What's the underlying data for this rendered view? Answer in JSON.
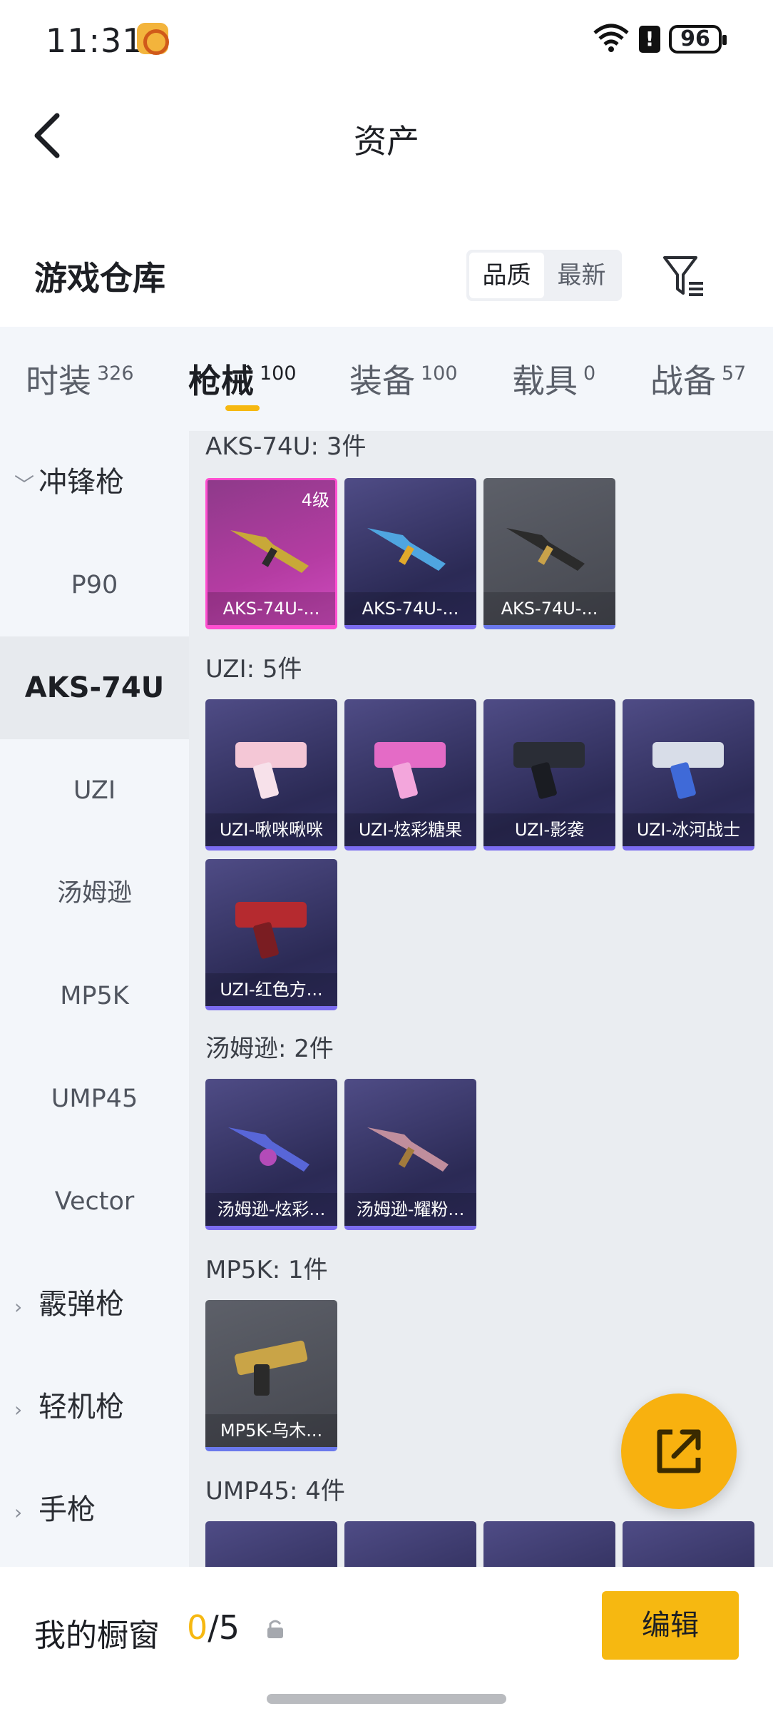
{
  "status_bar": {
    "time": "11:31",
    "battery": "96",
    "battery_alert": "!"
  },
  "header": {
    "title": "资产"
  },
  "warehouse": {
    "title": "游戏仓库",
    "sort_options": [
      "品质",
      "最新"
    ],
    "active_sort": "品质"
  },
  "tabs": [
    {
      "label": "时装",
      "count": "326"
    },
    {
      "label": "枪械",
      "count": "100"
    },
    {
      "label": "装备",
      "count": "100"
    },
    {
      "label": "载具",
      "count": "0"
    },
    {
      "label": "战备",
      "count": "57"
    }
  ],
  "active_tab": "枪械",
  "sidebar": {
    "categories": {
      "smg": "冲锋枪",
      "shotgun": "霰弹枪",
      "lmg": "轻机枪",
      "pistol": "手枪"
    },
    "smg_items": [
      "P90",
      "AKS-74U",
      "UZI",
      "汤姆逊",
      "MP5K",
      "UMP45",
      "Vector"
    ],
    "selected_item": "AKS-74U"
  },
  "groups": [
    {
      "label": "AKS-74U: 3件",
      "items": [
        {
          "name": "AKS-74U-...",
          "level": "4级",
          "rarity": "pink"
        },
        {
          "name": "AKS-74U-...",
          "rarity": "purple"
        },
        {
          "name": "AKS-74U-...",
          "rarity": "gray"
        }
      ]
    },
    {
      "label": "UZI: 5件",
      "items": [
        {
          "name": "UZI-啾咪啾咪",
          "rarity": "purple"
        },
        {
          "name": "UZI-炫彩糖果",
          "rarity": "purple"
        },
        {
          "name": "UZI-影袭",
          "rarity": "purple"
        },
        {
          "name": "UZI-冰河战士",
          "rarity": "purple"
        },
        {
          "name": "UZI-红色方...",
          "rarity": "purple"
        }
      ]
    },
    {
      "label": "汤姆逊: 2件",
      "items": [
        {
          "name": "汤姆逊-炫彩...",
          "rarity": "purple"
        },
        {
          "name": "汤姆逊-耀粉...",
          "rarity": "purple"
        }
      ]
    },
    {
      "label": "MP5K: 1件",
      "items": [
        {
          "name": "MP5K-乌木...",
          "rarity": "gray"
        }
      ]
    },
    {
      "label": "UMP45: 4件",
      "items": []
    }
  ],
  "bottom_bar": {
    "showcase_label": "我的橱窗",
    "showcase_current": "0",
    "showcase_total": "/5",
    "edit_label": "编辑"
  },
  "colors": {
    "accent": "#f6b811",
    "purple_rarity": "#7b6cf0",
    "pink_rarity": "#ff4fd0"
  },
  "icons": [
    "back-arrow-icon",
    "filter-icon",
    "share-icon",
    "lock-icon",
    "chevron-down-icon",
    "chevron-right-icon"
  ]
}
